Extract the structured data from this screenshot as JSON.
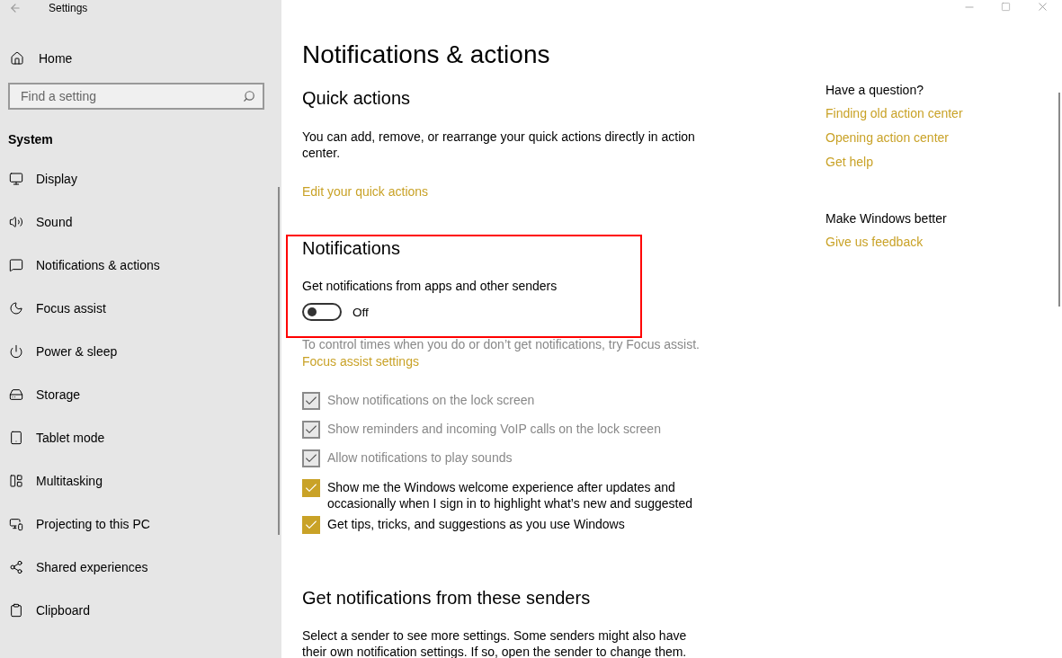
{
  "window": {
    "title": "Settings"
  },
  "sidebar": {
    "home": "Home",
    "search": {
      "placeholder": "Find a setting"
    },
    "section": "System",
    "items": [
      {
        "label": "Display"
      },
      {
        "label": "Sound"
      },
      {
        "label": "Notifications & actions"
      },
      {
        "label": "Focus assist"
      },
      {
        "label": "Power & sleep"
      },
      {
        "label": "Storage"
      },
      {
        "label": "Tablet mode"
      },
      {
        "label": "Multitasking"
      },
      {
        "label": "Projecting to this PC"
      },
      {
        "label": "Shared experiences"
      },
      {
        "label": "Clipboard"
      }
    ]
  },
  "main": {
    "title": "Notifications & actions",
    "quick_actions": {
      "heading": "Quick actions",
      "text": "You can add, remove, or rearrange your quick actions directly in action center.",
      "link": "Edit your quick actions"
    },
    "notifications": {
      "heading": "Notifications",
      "toggle_label": "Get notifications from apps and other senders",
      "toggle": {
        "on": false,
        "state_text": "Off"
      },
      "hint": "To control times when you do or don’t get notifications, try Focus assist.",
      "link": "Focus assist settings",
      "checkboxes": [
        {
          "label": "Show notifications on the lock screen",
          "checked": true,
          "disabled": true
        },
        {
          "label": "Show reminders and incoming VoIP calls on the lock screen",
          "checked": true,
          "disabled": true
        },
        {
          "label": "Allow notifications to play sounds",
          "checked": true,
          "disabled": true
        },
        {
          "label": "Show me the Windows welcome experience after updates and occasionally when I sign in to highlight what’s new and suggested",
          "checked": true,
          "disabled": false
        },
        {
          "label": "Get tips, tricks, and suggestions as you use Windows",
          "checked": true,
          "disabled": false
        }
      ]
    },
    "senders": {
      "heading": "Get notifications from these senders",
      "text": "Select a sender to see more settings. Some senders might also have their own notification settings. If so, open the sender to change them."
    }
  },
  "aside": {
    "groups": [
      {
        "heading": "Have a question?",
        "links": [
          "Finding old action center",
          "Opening action center",
          "Get help"
        ]
      },
      {
        "heading": "Make Windows better",
        "links": [
          "Give us feedback"
        ]
      }
    ]
  }
}
